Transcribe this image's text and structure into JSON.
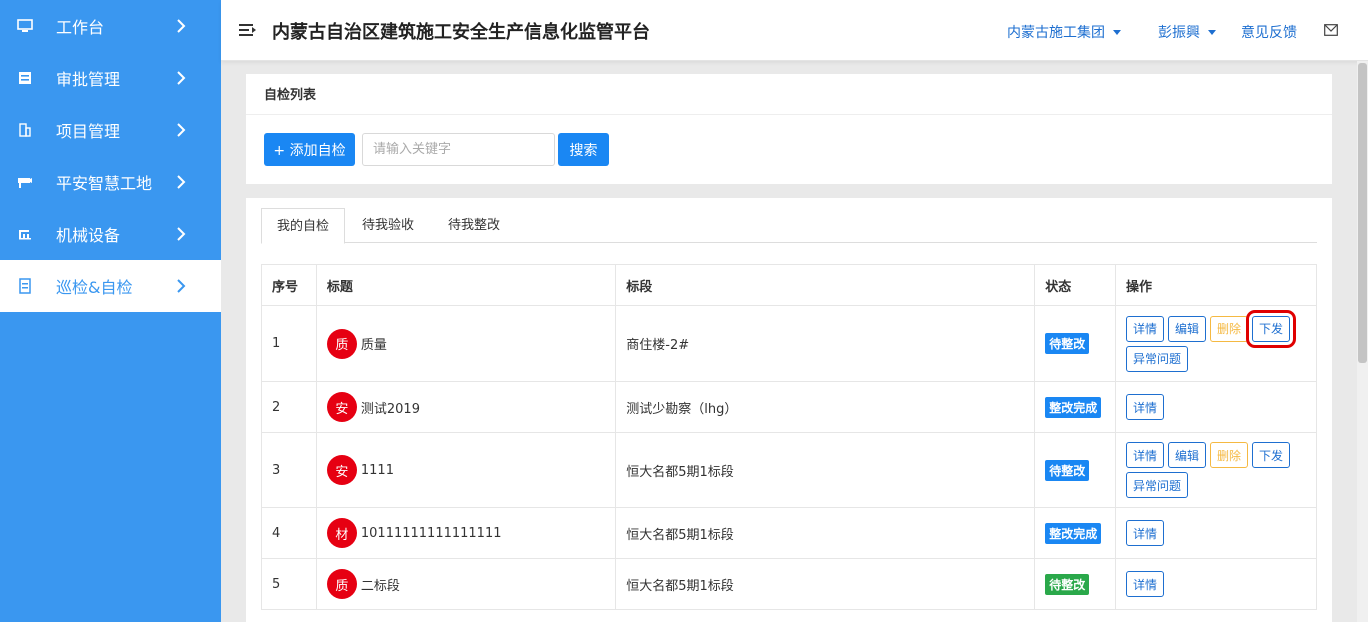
{
  "app": {
    "title": "内蒙古自治区建筑施工安全生产信息化监管平台"
  },
  "header": {
    "org_label": "内蒙古施工集团",
    "user_label": "彭振興",
    "feedback_label": "意见反馈",
    "mail_icon": "mail-icon"
  },
  "sidebar": {
    "items": [
      {
        "label": "工作台",
        "icon": "monitor-icon",
        "active": false
      },
      {
        "label": "审批管理",
        "icon": "approval-icon",
        "active": false
      },
      {
        "label": "项目管理",
        "icon": "building-icon",
        "active": false
      },
      {
        "label": "平安智慧工地",
        "icon": "camera-icon",
        "active": false
      },
      {
        "label": "机械设备",
        "icon": "machine-icon",
        "active": false
      },
      {
        "label": "巡检&自检",
        "icon": "clipboard-icon",
        "active": true
      }
    ]
  },
  "list_panel": {
    "title": "自检列表",
    "add_label": "+ 添加自检",
    "search_placeholder": "请输入关键字",
    "search_value": "",
    "search_label": "搜索"
  },
  "tabs": [
    {
      "label": "我的自检",
      "active": true
    },
    {
      "label": "待我验收",
      "active": false
    },
    {
      "label": "待我整改",
      "active": false
    }
  ],
  "table": {
    "columns": [
      "序号",
      "标题",
      "标段",
      "状态",
      "操作"
    ],
    "rows": [
      {
        "no": "1",
        "badge": "质",
        "title": "质量",
        "section": "商住楼-2#",
        "status": "待整改",
        "status_color": "#1a87f3",
        "actions": [
          "详情",
          "编辑",
          "删除",
          "下发",
          "异常问题"
        ]
      },
      {
        "no": "2",
        "badge": "安",
        "title": "测试2019",
        "section": "测试少勘察（lhg）",
        "status": "整改完成",
        "status_color": "#1a87f3",
        "actions": [
          "详情"
        ]
      },
      {
        "no": "3",
        "badge": "安",
        "title": "1111",
        "section": "恒大名都5期1标段",
        "status": "待整改",
        "status_color": "#1a87f3",
        "actions": [
          "详情",
          "编辑",
          "删除",
          "下发",
          "异常问题"
        ]
      },
      {
        "no": "4",
        "badge": "材",
        "title": "10111111111111111",
        "section": "恒大名都5期1标段",
        "status": "整改完成",
        "status_color": "#1a87f3",
        "actions": [
          "详情"
        ]
      },
      {
        "no": "5",
        "badge": "质",
        "title": "二标段",
        "section": "恒大名都5期1标段",
        "status": "待整改",
        "status_color": "#2aa84a",
        "actions": [
          "详情"
        ]
      }
    ]
  },
  "colors": {
    "sidebar": "#3a97f0",
    "primary": "#1a87f3",
    "danger_badge": "#e60012",
    "warn": "#f5b942",
    "highlight": "#e00000"
  }
}
